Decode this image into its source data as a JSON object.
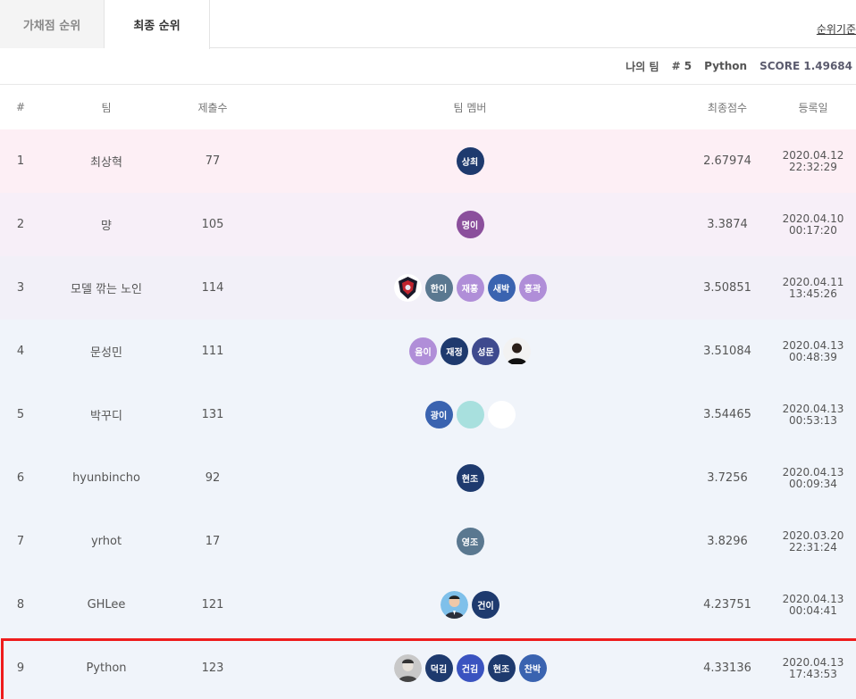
{
  "tabs": {
    "public": "가채점 순위",
    "final": "최종 순위"
  },
  "criteria_link": "순위기준",
  "my_team": {
    "label": "나의 팀",
    "rank": "# 5",
    "name": "Python",
    "score": "SCORE 1.49684"
  },
  "columns": {
    "rank": "#",
    "team": "팀",
    "submissions": "제출수",
    "members": "팀 멤버",
    "score": "최종점수",
    "date": "등록일"
  },
  "colors": {
    "highlight_border": "#ee1c1c",
    "navy": "#1e3a6e",
    "purple": "#8b4f9c",
    "lavender": "#b08ed8",
    "blue": "#3a63b0",
    "teal": "#a8e0de"
  },
  "rows": [
    {
      "rank": "1",
      "team": "최상혁",
      "submissions": "77",
      "score": "2.67974",
      "date": "2020.04.12",
      "time": "22:32:29",
      "bg": "#fdeff5",
      "members": [
        {
          "type": "text",
          "text": "상최",
          "color": "#1e3a6e"
        }
      ]
    },
    {
      "rank": "2",
      "team": "먕",
      "submissions": "105",
      "score": "3.3874",
      "date": "2020.04.10",
      "time": "00:17:20",
      "bg": "#f7eff8",
      "members": [
        {
          "type": "text",
          "text": "명이",
          "color": "#8b4f9c"
        }
      ]
    },
    {
      "rank": "3",
      "team": "모델 깎는 노인",
      "submissions": "114",
      "score": "3.50851",
      "date": "2020.04.11",
      "time": "13:45:26",
      "bg": "#f2f0f8",
      "members": [
        {
          "type": "emblem"
        },
        {
          "type": "text",
          "text": "한이",
          "color": "#5a7890"
        },
        {
          "type": "text",
          "text": "재홍",
          "color": "#b08ed8"
        },
        {
          "type": "text",
          "text": "새박",
          "color": "#3a63b0"
        },
        {
          "type": "text",
          "text": "홍곽",
          "color": "#b08ed8"
        }
      ]
    },
    {
      "rank": "4",
      "team": "문성민",
      "submissions": "111",
      "score": "3.51084",
      "date": "2020.04.13",
      "time": "00:48:39",
      "bg": "#f0f4fa",
      "members": [
        {
          "type": "text",
          "text": "윰이",
          "color": "#b08ed8"
        },
        {
          "type": "text",
          "text": "재정",
          "color": "#1e3a6e"
        },
        {
          "type": "text",
          "text": "성문",
          "color": "#3e4a8e"
        },
        {
          "type": "photo-dark"
        }
      ]
    },
    {
      "rank": "5",
      "team": "박꾸디",
      "submissions": "131",
      "score": "3.54465",
      "date": "2020.04.13",
      "time": "00:53:13",
      "bg": "#f0f4fa",
      "members": [
        {
          "type": "text",
          "text": "광이",
          "color": "#3a63b0"
        },
        {
          "type": "plain",
          "color": "#a8e0de"
        },
        {
          "type": "plain",
          "color": "#ffffff"
        }
      ]
    },
    {
      "rank": "6",
      "team": "hyunbincho",
      "submissions": "92",
      "score": "3.7256",
      "date": "2020.04.13",
      "time": "00:09:34",
      "bg": "#f0f4fa",
      "members": [
        {
          "type": "text",
          "text": "현조",
          "color": "#1e3a6e"
        }
      ]
    },
    {
      "rank": "7",
      "team": "yrhot",
      "submissions": "17",
      "score": "3.8296",
      "date": "2020.03.20",
      "time": "22:31:24",
      "bg": "#f0f4fa",
      "members": [
        {
          "type": "text",
          "text": "영조",
          "color": "#5a7890"
        }
      ]
    },
    {
      "rank": "8",
      "team": "GHLee",
      "submissions": "121",
      "score": "4.23751",
      "date": "2020.04.13",
      "time": "00:04:41",
      "bg": "#f0f4fa",
      "members": [
        {
          "type": "photo-light"
        },
        {
          "type": "text",
          "text": "건이",
          "color": "#1e3a6e"
        }
      ]
    },
    {
      "rank": "9",
      "team": "Python",
      "submissions": "123",
      "score": "4.33136",
      "date": "2020.04.13",
      "time": "17:43:53",
      "bg": "#f0f4fa",
      "highlight": true,
      "members": [
        {
          "type": "photo-gray"
        },
        {
          "type": "text",
          "text": "덕김",
          "color": "#1e3a6e"
        },
        {
          "type": "text",
          "text": "건김",
          "color": "#3a53c0"
        },
        {
          "type": "text",
          "text": "현조",
          "color": "#1e3a6e"
        },
        {
          "type": "text",
          "text": "찬박",
          "color": "#3a63b0"
        }
      ]
    }
  ]
}
